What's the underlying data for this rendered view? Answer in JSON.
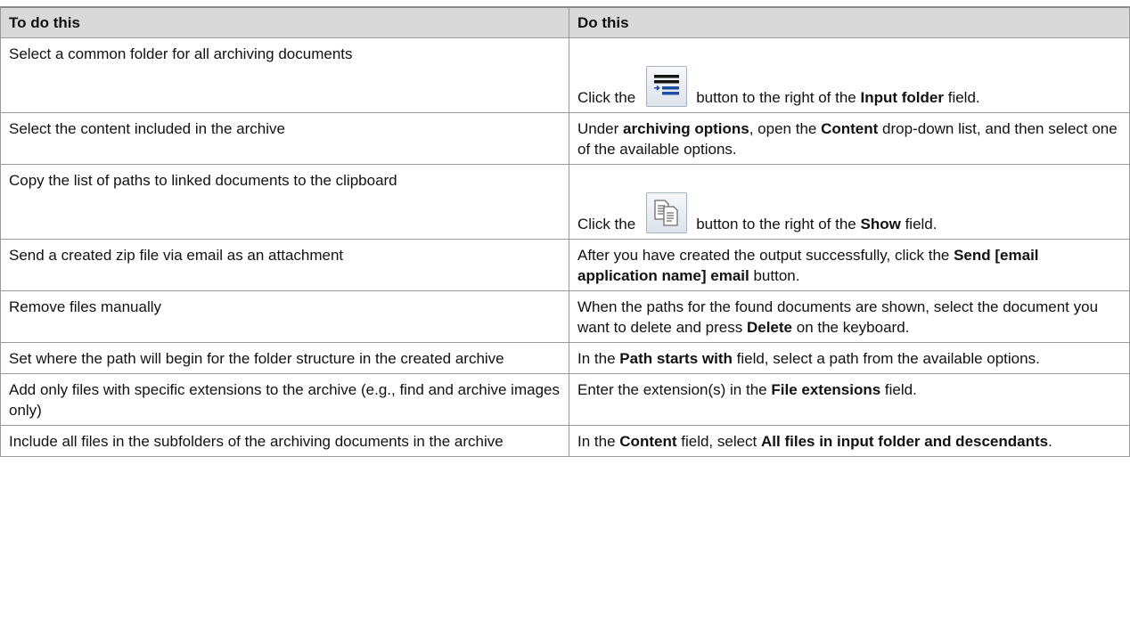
{
  "table": {
    "headers": [
      "To do this",
      "Do this"
    ],
    "rows": [
      {
        "task": "Select a common folder for all archiving documents",
        "action": {
          "before": "Click the",
          "icon": "input-folder-browse-icon",
          "after": "button to the right of the",
          "bold": "Input folder",
          "end": "field."
        }
      },
      {
        "task": "Select the content included in the archive",
        "action": {
          "t1": "Under",
          "b1": "archiving options",
          "t2": ", open the",
          "b2": "Content",
          "t3": "drop-down list, and then select one of the available options."
        }
      },
      {
        "task": "Copy the list of paths to linked documents to the clipboard",
        "action": {
          "before": "Click the",
          "icon": "copy-to-clipboard-icon",
          "after": "button to the right of the",
          "bold": "Show",
          "end": "field."
        }
      },
      {
        "task": "Send a created zip file via email as an attachment",
        "action": {
          "t1": "After you have created the output successfully, click the",
          "b1": "Send [email application name] email",
          "t2": "button."
        }
      },
      {
        "task": "Remove files manually",
        "action": {
          "t1": "When the paths for the found documents are shown, select the document you want to delete and press",
          "b1": "Delete",
          "t2": "on the keyboard."
        }
      },
      {
        "task": "Set where the path will begin for the folder structure in the created archive",
        "action": {
          "t1": "In the",
          "b1": "Path starts with",
          "t2": "field, select a path from the available options."
        }
      },
      {
        "task": "Add only files with specific extensions to the archive (e.g., find and archive images only)",
        "action": {
          "t1": "Enter the extension(s) in the",
          "b1": "File extensions",
          "t2": "field."
        }
      },
      {
        "task": "Include all files in the subfolders of the archiving documents in the archive",
        "action": {
          "t1": "In the",
          "b1": "Content",
          "t2": "field, select",
          "b2": "All files in input folder and descendants",
          "t3": "."
        }
      }
    ]
  },
  "colors": {
    "header_bg": "#d9d9d9",
    "border": "#9a9a9a",
    "icon_blue": "#1f4ea3"
  }
}
